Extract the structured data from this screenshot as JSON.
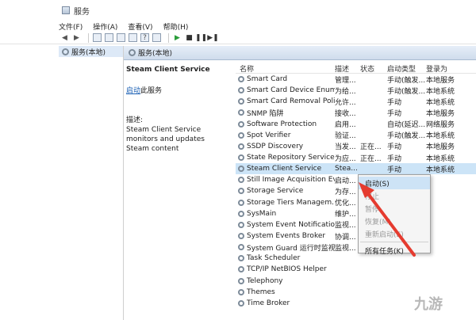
{
  "window": {
    "title": "服务"
  },
  "menu": {
    "items": [
      "文件(F)",
      "操作(A)",
      "查看(V)",
      "帮助(H)"
    ]
  },
  "tree": {
    "root_label": "服务(本地)"
  },
  "pane": {
    "header": "服务(本地)"
  },
  "detail": {
    "service_title": "Steam Client Service",
    "start_link": "启动",
    "start_suffix": "此服务",
    "description_label": "描述:",
    "description_text": "Steam Client Service monitors and updates Steam content"
  },
  "table": {
    "columns": [
      "名称",
      "描述",
      "状态",
      "启动类型",
      "登录为"
    ],
    "rows": [
      [
        "Smart Card",
        "管理...",
        "",
        "手动(触发...",
        "本地服务"
      ],
      [
        "Smart Card Device Enum...",
        "为给...",
        "",
        "手动(触发...",
        "本地系统"
      ],
      [
        "Smart Card Removal Poli...",
        "允许...",
        "",
        "手动",
        "本地系统"
      ],
      [
        "SNMP 陷阱",
        "接收...",
        "",
        "手动",
        "本地服务"
      ],
      [
        "Software Protection",
        "启用...",
        "",
        "自动(延迟...",
        "网络服务"
      ],
      [
        "Spot Verifier",
        "验证...",
        "",
        "手动(触发...",
        "本地系统"
      ],
      [
        "SSDP Discovery",
        "当发...",
        "正在...",
        "手动",
        "本地服务"
      ],
      [
        "State Repository Service",
        "为应...",
        "正在...",
        "手动",
        "本地系统"
      ],
      [
        "Steam Client Service",
        "Stea...",
        "",
        "手动",
        "本地系统"
      ],
      [
        "Still Image Acquisition Ev...",
        "启动...",
        "",
        "",
        ""
      ],
      [
        "Storage Service",
        "为存...",
        "",
        "",
        ""
      ],
      [
        "Storage Tiers Managem...",
        "优化...",
        "",
        "",
        ""
      ],
      [
        "SysMain",
        "维护...",
        "",
        "",
        ""
      ],
      [
        "System Event Notification...",
        "监视...",
        "",
        "",
        ""
      ],
      [
        "System Events Broker",
        "协调...",
        "",
        "",
        ""
      ],
      [
        "System Guard 运行时监视...",
        "监视...",
        "",
        "",
        ""
      ],
      [
        "Task Scheduler",
        "",
        "",
        "",
        ""
      ],
      [
        "TCP/IP NetBIOS Helper",
        "",
        "",
        "",
        ""
      ],
      [
        "Telephony",
        "",
        "",
        "",
        ""
      ],
      [
        "Themes",
        "",
        "",
        "",
        ""
      ],
      [
        "Time Broker",
        "",
        "",
        "",
        ""
      ]
    ],
    "selected_index": 8
  },
  "context_menu": {
    "items": [
      "启动(S)",
      "停止",
      "暂停",
      "恢复(M)",
      "重新启动(E)"
    ],
    "extra": "所有任务(K)"
  },
  "watermark": "九游"
}
